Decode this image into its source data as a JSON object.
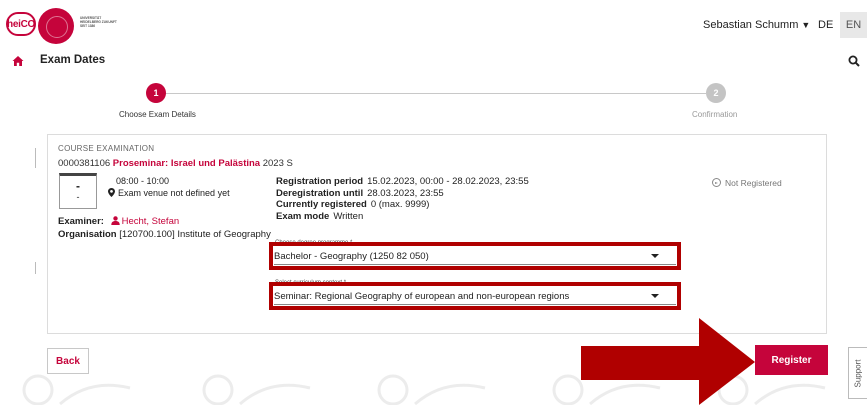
{
  "header": {
    "logo_text": "heiCO",
    "university_text": "UNIVERSITÄT HEIDELBERG ZUKUNFT SEIT 1386",
    "user_name": "Sebastian Schumm",
    "lang_de": "DE",
    "lang_en": "EN"
  },
  "nav": {
    "page_title": "Exam Dates"
  },
  "stepper": {
    "steps": [
      {
        "number": "1",
        "label": "Choose Exam Details",
        "active": true
      },
      {
        "number": "2",
        "label": "Confirmation",
        "active": false
      }
    ]
  },
  "exam": {
    "section_label": "COURSE EXAMINATION",
    "course_number": "0000381106",
    "course_title": "Proseminar: Israel und Palästina",
    "semester": "2023 S",
    "date_top": "-",
    "date_bottom": "-",
    "time": "08:00 - 10:00",
    "venue": "Exam venue not defined yet",
    "examiner_label": "Examiner:",
    "examiner_name": "Hecht, Stefan",
    "organisation_label": "Organisation",
    "organisation_value": "[120700.100] Institute of Geography",
    "registration": [
      {
        "key": "Registration period",
        "value": "15.02.2023, 00:00 - 28.02.2023, 23:55"
      },
      {
        "key": "Deregistration until",
        "value": "28.03.2023, 23:55"
      },
      {
        "key": "Currently registered",
        "value": "0 (max. 9999)"
      },
      {
        "key": "Exam mode",
        "value": "Written"
      }
    ],
    "status": "Not Registered"
  },
  "form": {
    "degree_label": "Choose degree programme *",
    "degree_value": "Bachelor - Geography (1250 82 050)",
    "context_label": "Select curriculum context *",
    "context_value": "Seminar: Regional Geography of european and non-european regions"
  },
  "actions": {
    "back_label": "Back",
    "register_label": "Register",
    "support_label": "Support"
  },
  "colors": {
    "brand": "#c5043b",
    "highlight": "#b00000"
  }
}
